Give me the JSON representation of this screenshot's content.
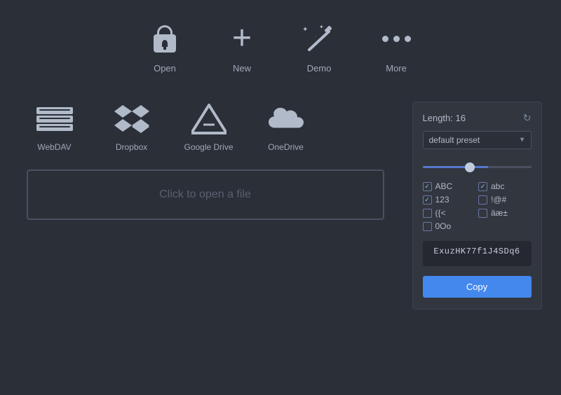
{
  "toolbar": {
    "items": [
      {
        "id": "open",
        "label": "Open"
      },
      {
        "id": "new",
        "label": "New"
      },
      {
        "id": "demo",
        "label": "Demo"
      },
      {
        "id": "more",
        "label": "More"
      }
    ]
  },
  "services": [
    {
      "id": "webdav",
      "label": "WebDAV"
    },
    {
      "id": "dropbox",
      "label": "Dropbox"
    },
    {
      "id": "gdrive",
      "label": "Google Drive"
    },
    {
      "id": "onedrive",
      "label": "OneDrive"
    }
  ],
  "file_area": {
    "placeholder": "Click to open a file"
  },
  "password_generator": {
    "length_label": "Length: 16",
    "preset_label": "default preset",
    "options": [
      {
        "id": "abc_upper",
        "label": "ABC",
        "checked": true
      },
      {
        "id": "abc_lower",
        "label": "abc",
        "checked": true
      },
      {
        "id": "numbers",
        "label": "123",
        "checked": true
      },
      {
        "id": "special",
        "label": "!@#",
        "checked": false
      },
      {
        "id": "brackets",
        "label": "({<",
        "checked": false
      },
      {
        "id": "accented",
        "label": "äæ±",
        "checked": false
      },
      {
        "id": "ambiguous",
        "label": "0Oo",
        "checked": false
      }
    ],
    "generated": "ExuzHK77f1J4SDq6",
    "copy_label": "Copy"
  }
}
